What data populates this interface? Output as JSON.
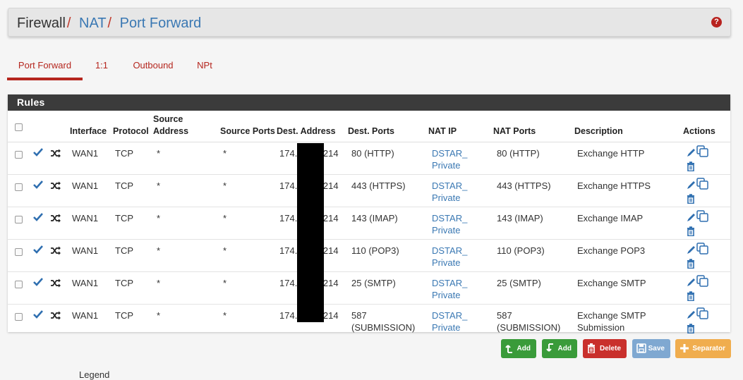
{
  "breadcrumb": {
    "root": "Firewall",
    "separator": "/",
    "items": [
      "NAT",
      "Port Forward"
    ]
  },
  "help_icon": "question-circle-icon",
  "tabs": [
    {
      "label": "Port Forward",
      "active": true
    },
    {
      "label": "1:1",
      "active": false
    },
    {
      "label": "Outbound",
      "active": false
    },
    {
      "label": "NPt",
      "active": false
    }
  ],
  "panel": {
    "title": "Rules",
    "columns": {
      "interface": "Interface",
      "protocol": "Protocol",
      "source_address": "Source Address",
      "source_ports": "Source Ports",
      "dest_address": "Dest. Address",
      "dest_ports": "Dest. Ports",
      "nat_ip": "NAT IP",
      "nat_ports": "NAT Ports",
      "description": "Description",
      "actions": "Actions"
    },
    "rows": [
      {
        "interface": "WAN1",
        "protocol": "TCP",
        "source_address": "*",
        "source_ports": "*",
        "dest_prefix": "174.",
        "dest_suffix": ".214",
        "dest_ports": "80 (HTTP)",
        "nat_ip_1": "DSTAR_",
        "nat_ip_2": "Private",
        "nat_ports": "80 (HTTP)",
        "description": "Exchange HTTP"
      },
      {
        "interface": "WAN1",
        "protocol": "TCP",
        "source_address": "*",
        "source_ports": "*",
        "dest_prefix": "174.",
        "dest_suffix": ".214",
        "dest_ports": "443 (HTTPS)",
        "nat_ip_1": "DSTAR_",
        "nat_ip_2": "Private",
        "nat_ports": "443 (HTTPS)",
        "description": "Exchange HTTPS"
      },
      {
        "interface": "WAN1",
        "protocol": "TCP",
        "source_address": "*",
        "source_ports": "*",
        "dest_prefix": "174.",
        "dest_suffix": ".214",
        "dest_ports": "143 (IMAP)",
        "nat_ip_1": "DSTAR_",
        "nat_ip_2": "Private",
        "nat_ports": "143 (IMAP)",
        "description": "Exchange IMAP"
      },
      {
        "interface": "WAN1",
        "protocol": "TCP",
        "source_address": "*",
        "source_ports": "*",
        "dest_prefix": "174.",
        "dest_suffix": ".214",
        "dest_ports": "110 (POP3)",
        "nat_ip_1": "DSTAR_",
        "nat_ip_2": "Private",
        "nat_ports": "110 (POP3)",
        "description": "Exchange POP3"
      },
      {
        "interface": "WAN1",
        "protocol": "TCP",
        "source_address": "*",
        "source_ports": "*",
        "dest_prefix": "174.",
        "dest_suffix": ".214",
        "dest_ports": "25 (SMTP)",
        "nat_ip_1": "DSTAR_",
        "nat_ip_2": "Private",
        "nat_ports": "25 (SMTP)",
        "description": "Exchange SMTP"
      },
      {
        "interface": "WAN1",
        "protocol": "TCP",
        "source_address": "*",
        "source_ports": "*",
        "dest_prefix": "174.",
        "dest_suffix": ".214",
        "dest_ports": "587\n(SUBMISSION)",
        "nat_ip_1": "DSTAR_",
        "nat_ip_2": "Private",
        "nat_ports": "587\n(SUBMISSION)",
        "description": "Exchange SMTP\nSubmission"
      }
    ]
  },
  "buttons": {
    "add_top": "Add",
    "add_bottom": "Add",
    "delete": "Delete",
    "save": "Save",
    "separator": "Separator"
  },
  "colors": {
    "accent_red": "#b5261e",
    "link_blue": "#3a78b3",
    "success_green": "#3a9b3a",
    "danger_red": "#c9302c",
    "save_blue": "#7fa8d1",
    "warning_orange": "#f0ad4e"
  },
  "footer_partial": "Legend"
}
